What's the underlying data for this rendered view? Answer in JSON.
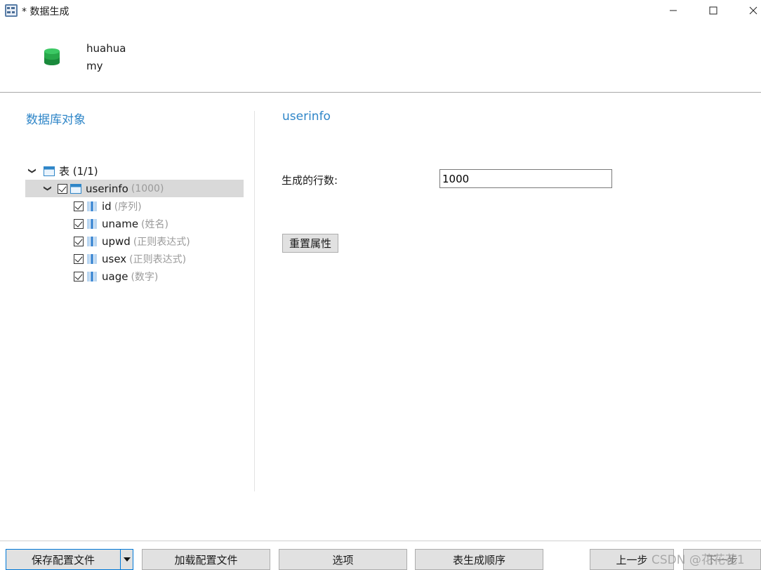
{
  "window": {
    "title": "* 数据生成",
    "controls": [
      "minimize-icon",
      "maximize-icon",
      "close-icon"
    ]
  },
  "connection": {
    "name": "huahua",
    "database": "my",
    "icon": "database-icon",
    "icon_color": "#22a34a"
  },
  "left_panel": {
    "title": "数据库对象",
    "tree": {
      "root": {
        "label": "表 (1/1)",
        "expanded": true
      },
      "table": {
        "label": "userinfo",
        "hint": "(1000)",
        "checked": true,
        "selected": true
      },
      "columns": [
        {
          "label": "id",
          "hint": "(序列)",
          "checked": true
        },
        {
          "label": "uname",
          "hint": "(姓名)",
          "checked": true
        },
        {
          "label": "upwd",
          "hint": "(正则表达式)",
          "checked": true
        },
        {
          "label": "usex",
          "hint": "(正则表达式)",
          "checked": true
        },
        {
          "label": "uage",
          "hint": "(数字)",
          "checked": true
        }
      ]
    }
  },
  "right_panel": {
    "title": "userinfo",
    "rows_label": "生成的行数:",
    "rows_value": "1000",
    "reset_button": "重置属性"
  },
  "bottom_bar": {
    "save_config": "保存配置文件",
    "load_config": "加载配置文件",
    "options": "选项",
    "table_order": "表生成顺序",
    "prev": "上一步",
    "next": "下一步"
  },
  "watermark": "CSDN @花花花1",
  "colors": {
    "accent": "#2f86c8",
    "selection": "#d9d9d9",
    "focus_border": "#0078d7"
  }
}
